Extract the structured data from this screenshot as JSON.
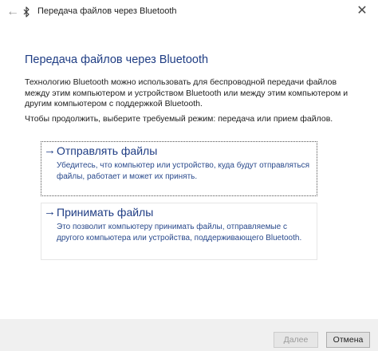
{
  "window": {
    "back_glyph": "←",
    "title": "Передача файлов через Bluetooth",
    "close_glyph": "✕",
    "icon": "bluetooth-icon"
  },
  "main": {
    "heading": "Передача файлов через Bluetooth",
    "description": "Технологию Bluetooth можно использовать для беспроводной передачи файлов между этим компьютером и устройством Bluetooth или между этим компьютером и другим компьютером с поддержкой Bluetooth.",
    "prompt": "Чтобы продолжить, выберите требуемый режим: передача или прием файлов."
  },
  "options": [
    {
      "arrow": "→",
      "title": "Отправлять файлы",
      "description": "Убедитесь, что компьютер или устройство, куда будут отправляться файлы, работает и может их принять.",
      "focused": true
    },
    {
      "arrow": "→",
      "title": "Принимать файлы",
      "description": "Это позволит компьютеру принимать файлы, отправляемые с другого компьютера или устройства, поддерживающего Bluetooth.",
      "focused": false
    }
  ],
  "footer": {
    "next_label": "Далее",
    "next_enabled": false,
    "cancel_label": "Отмена"
  },
  "colors": {
    "accent": "#1f3d84",
    "footer_bg": "#f0f0f0"
  }
}
